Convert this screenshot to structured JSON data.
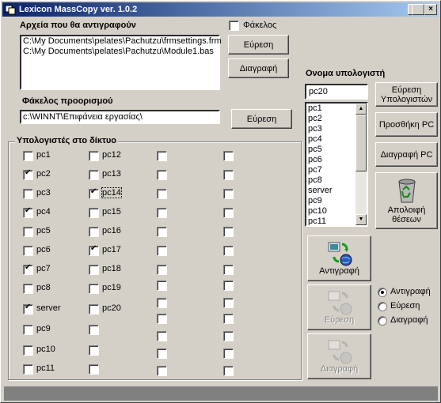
{
  "window": {
    "title": "Lexicon MassCopy ver. 1.0.2",
    "min_label": "_",
    "max_label": "□",
    "close_label": "×"
  },
  "files": {
    "label": "Αρχεία που θα αντιγραφούν",
    "folder_checkbox_label": "Φάκελος",
    "folder_checked": false,
    "items": [
      "C:\\My Documents\\pelates\\Pachutzu\\frmsettings.frm",
      "C:\\My Documents\\pelates\\Pachutzu\\Module1.bas"
    ],
    "browse_label": "Εύρεση",
    "delete_label": "Διαγραφή"
  },
  "destination": {
    "label": "Φάκελος προορισμού",
    "value": "c:\\WINNT\\Επιφάνεια εργασίας\\",
    "browse_label": "Εύρεση"
  },
  "network": {
    "label": "Υπολογιστές στο δίκτυο",
    "columns": [
      [
        {
          "name": "pc1",
          "checked": false
        },
        {
          "name": "pc2",
          "checked": true
        },
        {
          "name": "pc3",
          "checked": false
        },
        {
          "name": "pc4",
          "checked": true
        },
        {
          "name": "pc5",
          "checked": false
        },
        {
          "name": "pc6",
          "checked": false
        },
        {
          "name": "pc7",
          "checked": true
        },
        {
          "name": "pc8",
          "checked": false
        },
        {
          "name": "server",
          "checked": true
        },
        {
          "name": "pc9",
          "checked": false
        },
        {
          "name": "pc10",
          "checked": false
        },
        {
          "name": "pc11",
          "checked": false
        }
      ],
      [
        {
          "name": "pc12",
          "checked": false
        },
        {
          "name": "pc13",
          "checked": false
        },
        {
          "name": "pc14",
          "checked": true
        },
        {
          "name": "pc15",
          "checked": false
        },
        {
          "name": "pc16",
          "checked": false
        },
        {
          "name": "pc17",
          "checked": true
        },
        {
          "name": "pc18",
          "checked": false
        },
        {
          "name": "pc19",
          "checked": false
        },
        {
          "name": "pc20",
          "checked": false
        },
        {
          "name": "",
          "checked": false
        },
        {
          "name": "",
          "checked": false
        },
        {
          "name": "",
          "checked": false
        }
      ]
    ]
  },
  "computer": {
    "label": "Ονομα υπολογιστή",
    "input_value": "pc20",
    "list": [
      "pc1",
      "pc2",
      "pc3",
      "pc4",
      "pc5",
      "pc6",
      "pc7",
      "pc8",
      "server",
      "pc9",
      "pc10",
      "pc11"
    ],
    "find_label": "Εύρεση Υπολογιστών",
    "add_label": "Προσθήκη PC",
    "remove_label": "Διαγραφή PC",
    "recycle_label": "Απολοιφή θέσεων"
  },
  "actions": {
    "copy_label": "Αντιγραφή",
    "find_label": "Εύρεση",
    "delete_label": "Διαγραφή"
  },
  "mode": {
    "options": [
      {
        "label": "Αντιγραφή",
        "selected": true
      },
      {
        "label": "Εύρεση",
        "selected": false
      },
      {
        "label": "Διαγραφή",
        "selected": false
      }
    ]
  },
  "colors": {
    "titlebar_start": "#0a246a",
    "titlebar_end": "#a6caf0",
    "face": "#d4d0c8",
    "statusbar": "#808080"
  }
}
